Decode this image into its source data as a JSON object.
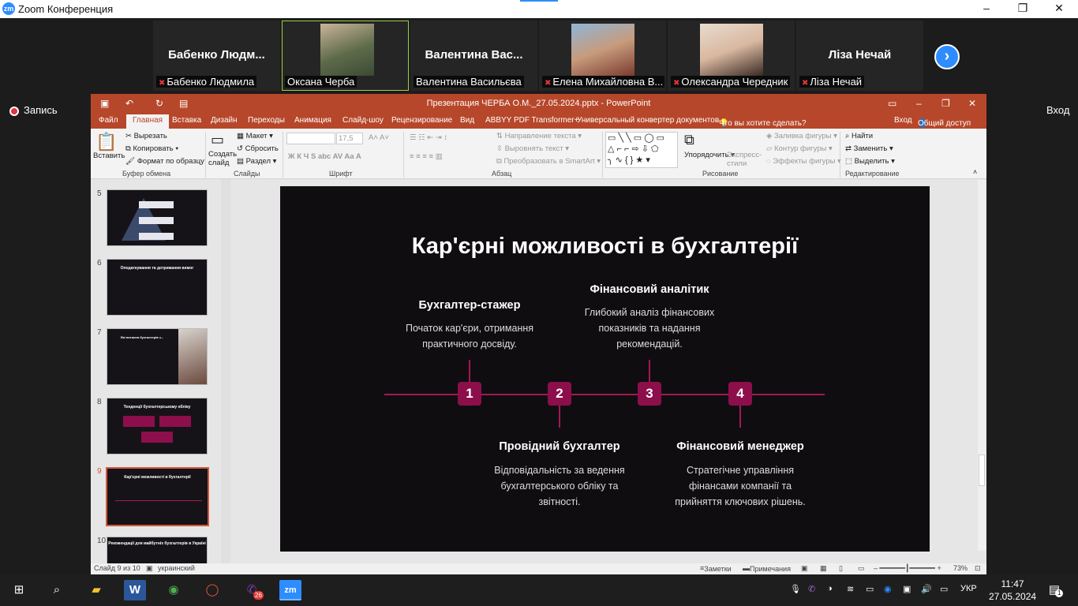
{
  "zoom": {
    "app_title": "Zoom Конференция",
    "logo": "zm",
    "controls": {
      "minimize": "–",
      "restore": "❐",
      "close": "✕"
    },
    "record_label": "Запись",
    "login_label": "Вход",
    "participants": [
      {
        "display_name": "Бабенко  Людм...",
        "label": "Бабенко Людмила"
      },
      {
        "display_name": "",
        "label": "Оксана Черба"
      },
      {
        "display_name": "Валентина  Вас...",
        "label": "Валентина Васильєва"
      },
      {
        "display_name": "",
        "label": "Елена Михайловна В..."
      },
      {
        "display_name": "",
        "label": "Олександра Чередник"
      },
      {
        "display_name": "Ліза Нечай",
        "label": "Ліза Нечай"
      }
    ]
  },
  "ppt": {
    "window_title": "Презентация ЧЕРБА О.М._27.05.2024.pptx - PowerPoint",
    "tabs": [
      "Файл",
      "Главная",
      "Вставка",
      "Дизайн",
      "Переходы",
      "Анимация",
      "Слайд-шоу",
      "Рецензирование",
      "Вид",
      "ABBYY PDF Transformer+",
      "Универсальный конвертер документов"
    ],
    "tellme": "Что вы хотите сделать?",
    "signin": "Вход",
    "share": "Общий доступ",
    "ribbon": {
      "paste": "Вставить",
      "cut": "Вырезать",
      "copy": "Копировать",
      "format_painter": "Формат по образцу",
      "clipboard_group": "Буфер обмена",
      "new_slide": "Создать слайд",
      "layout": "Макет",
      "reset": "Сбросить",
      "section": "Раздел",
      "slides_group": "Слайды",
      "font_size": "17,5",
      "font_group": "Шрифт",
      "text_direction": "Направление текста",
      "align_text": "Выровнять текст",
      "convert_smartart": "Преобразовать в SmartArt",
      "paragraph_group": "Абзац",
      "arrange": "Упорядочить",
      "quick_styles": "Экспресс-стили",
      "shape_fill": "Заливка фигуры",
      "shape_outline": "Контур фигуры",
      "shape_effects": "Эффекты фигуры",
      "drawing_group": "Рисование",
      "find": "Найти",
      "replace": "Заменить",
      "select": "Выделить",
      "editing_group": "Редактирование"
    },
    "thumbnails": [
      {
        "num": "5",
        "title": ""
      },
      {
        "num": "6",
        "title": "Оподаткування та дотримання вимог"
      },
      {
        "num": "7",
        "title": "Які питання бухгалтерів з..."
      },
      {
        "num": "8",
        "title": "Тенденції бухгалтерському обліку"
      },
      {
        "num": "9",
        "title": "Кар'єрні можливості в бухгалтерії"
      },
      {
        "num": "10",
        "title": "Рекомендації для майбутніх бухгалтерів в Україні"
      }
    ],
    "slide": {
      "title": "Кар'єрні можливості в бухгалтерії",
      "steps": [
        {
          "num": "1",
          "heading": "Бухгалтер-стажер",
          "desc": "Початок кар'єри, отримання практичного досвіду."
        },
        {
          "num": "2",
          "heading": "Провідний бухгалтер",
          "desc": "Відповідальність за ведення бухгалтерського обліку та звітності."
        },
        {
          "num": "3",
          "heading": "Фінансовий аналітик",
          "desc": "Глибокий аналіз фінансових показників та надання рекомендацій."
        },
        {
          "num": "4",
          "heading": "Фінансовий менеджер",
          "desc": "Стратегічне управління фінансами компанії та прийняття ключових рішень."
        }
      ],
      "colors": {
        "background": "#100d11",
        "accent": "#8c0f4c",
        "line": "#a01a55"
      }
    },
    "status": {
      "slide_info": "Слайд 9 из 10",
      "language": "украинский",
      "notes": "Заметки",
      "comments": "Примечания",
      "zoom": "73%"
    }
  },
  "taskbar": {
    "language": "УКР",
    "time": "11:47",
    "date": "27.05.2024",
    "viber_badge": "26",
    "notification_count": "1"
  }
}
